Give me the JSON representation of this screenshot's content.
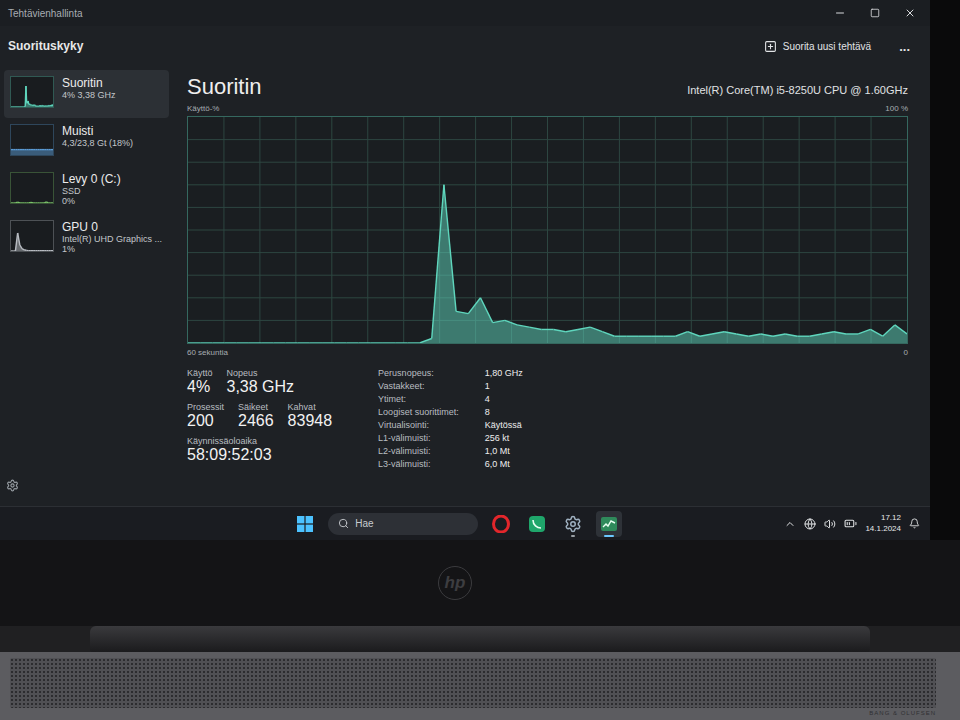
{
  "window": {
    "title": "Tehtävienhallinta"
  },
  "header": {
    "title": "Suorituskyky",
    "run_task": "Suorita uusi tehtävä",
    "more": "..."
  },
  "sidebar": {
    "items": [
      {
        "name": "Suoritin",
        "lines": [
          "4% 3,38 GHz"
        ],
        "selected": true,
        "color": "#5fd6bd",
        "graph": [
          0,
          0,
          0,
          0,
          0,
          0,
          0,
          0,
          0,
          0,
          0,
          0,
          0,
          0,
          0,
          0,
          0,
          0,
          0,
          0,
          2,
          70,
          14,
          13,
          20,
          9,
          10,
          8,
          7,
          6,
          6,
          5,
          6,
          7,
          5,
          3,
          3,
          3,
          3,
          3,
          3,
          5,
          3,
          4,
          5,
          4,
          3,
          4,
          3,
          4,
          3,
          3,
          4,
          5,
          4,
          4,
          6,
          3,
          8,
          4
        ]
      },
      {
        "name": "Muisti",
        "lines": [
          "4,3/23,8 Gt (18%)"
        ],
        "selected": false,
        "color": "#5b9bd5",
        "graph": [
          18,
          18,
          18,
          18,
          18,
          18,
          18,
          18,
          18,
          18,
          18,
          18,
          18,
          18,
          18,
          18,
          18,
          18,
          18,
          18
        ]
      },
      {
        "name": "Levy 0 (C:)",
        "lines": [
          "SSD",
          "0%"
        ],
        "selected": false,
        "color": "#7cc46a",
        "graph": [
          0,
          0,
          0,
          3,
          0,
          0,
          0,
          0,
          0,
          2,
          0,
          0,
          0,
          0,
          0,
          0,
          4,
          0,
          0,
          0
        ]
      },
      {
        "name": "GPU 0",
        "lines": [
          "Intel(R) UHD Graphics ...",
          "1%"
        ],
        "selected": false,
        "color": "#b8bcc2",
        "graph": [
          0,
          0,
          0,
          60,
          20,
          8,
          4,
          2,
          1,
          1,
          1,
          1,
          1,
          1,
          1,
          1,
          1,
          1,
          1,
          1
        ]
      }
    ]
  },
  "main": {
    "title": "Suoritin",
    "cpu_name": "Intel(R) Core(TM) i5-8250U CPU @ 1.60GHz",
    "chart": {
      "y_label": "Käyttö-%",
      "y_max": "100 %",
      "x_label": "60 sekuntia",
      "x_min": "0",
      "values": [
        0,
        0,
        0,
        0,
        0,
        0,
        0,
        0,
        0,
        0,
        0,
        0,
        0,
        0,
        0,
        0,
        0,
        0,
        0,
        0,
        2,
        70,
        14,
        13,
        20,
        9,
        10,
        8,
        7,
        6,
        6,
        5,
        6,
        7,
        5,
        3,
        3,
        3,
        3,
        3,
        3,
        5,
        3,
        4,
        5,
        4,
        3,
        4,
        3,
        4,
        3,
        3,
        4,
        5,
        4,
        4,
        6,
        3,
        8,
        4
      ]
    },
    "stats": [
      {
        "label": "Käyttö",
        "value": "4%"
      },
      {
        "label": "Nopeus",
        "value": "3,38 GHz"
      }
    ],
    "counts": [
      {
        "label": "Prosessit",
        "value": "200"
      },
      {
        "label": "Säikeet",
        "value": "2466"
      },
      {
        "label": "Kahvat",
        "value": "83948"
      }
    ],
    "uptime": {
      "label": "Käynnissäoloaika",
      "value": "58:09:52:03"
    },
    "details": [
      {
        "label": "Perusnopeus:",
        "value": "1,80 GHz"
      },
      {
        "label": "Vastakkeet:",
        "value": "1"
      },
      {
        "label": "Ytimet:",
        "value": "4"
      },
      {
        "label": "Loogiset suorittimet:",
        "value": "8"
      },
      {
        "label": "Virtualisointi:",
        "value": "Käytössä"
      },
      {
        "label": "L1-välimuisti:",
        "value": "256 kt"
      },
      {
        "label": "L2-välimuisti:",
        "value": "1,0 Mt"
      },
      {
        "label": "L3-välimuisti:",
        "value": "6,0 Mt"
      }
    ]
  },
  "taskbar": {
    "search_placeholder": "Hae",
    "apps": [
      {
        "kind": "opera",
        "running": false,
        "active": false
      },
      {
        "kind": "store",
        "running": false,
        "active": false
      },
      {
        "kind": "settings",
        "running": true,
        "active": false
      },
      {
        "kind": "taskmanager",
        "running": true,
        "active": true
      }
    ],
    "time": "17.12",
    "date": "14.1.2024"
  },
  "laptop": {
    "logo": "hp",
    "brand": "BANG & OLUFSEN"
  }
}
